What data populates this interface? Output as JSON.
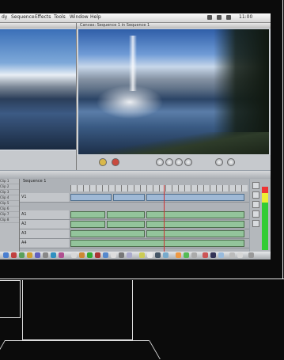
{
  "menubar": {
    "items": [
      "dy",
      "Sequence",
      "Effects",
      "Tools",
      "Window",
      "Help"
    ],
    "clock": "11:00"
  },
  "viewer": {
    "title": ""
  },
  "canvas": {
    "title": "Canvas: Sequence 1 in Sequence 1"
  },
  "browser": {
    "rows": [
      "Clip 1",
      "Clip 2",
      "Clip 3",
      "Clip 4",
      "Clip 5",
      "Clip 6",
      "Clip 7",
      "Clip 8"
    ]
  },
  "timeline": {
    "tab": "Sequence 1",
    "tracks": [
      {
        "label": "V1",
        "kind": "video"
      },
      {
        "label": "A1",
        "kind": "audio"
      },
      {
        "label": "A2",
        "kind": "audio"
      },
      {
        "label": "A3",
        "kind": "audio"
      },
      {
        "label": "A4",
        "kind": "audio"
      }
    ]
  },
  "colors": {
    "accent": "#9fb9d6",
    "audio": "#93c49b"
  },
  "icons": [
    "apple-icon",
    "play-icon",
    "stop-icon",
    "forward-icon",
    "back-icon",
    "razor-icon",
    "pen-icon",
    "zoom-icon"
  ]
}
